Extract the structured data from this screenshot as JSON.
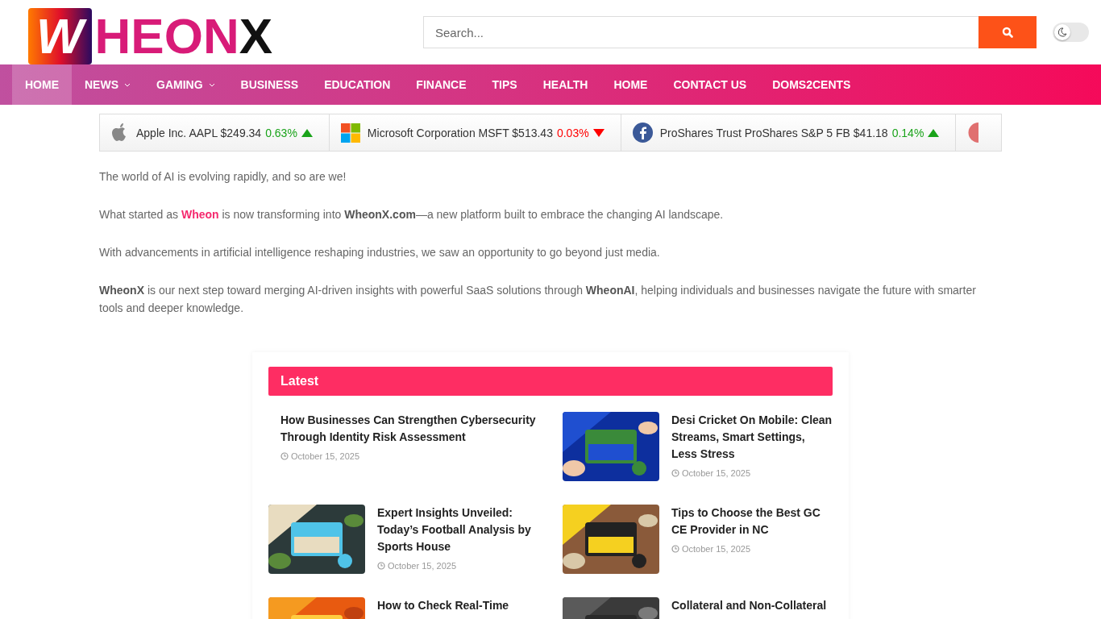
{
  "logo": {
    "mark": "W",
    "name": "HEON",
    "suffix": "X"
  },
  "search": {
    "placeholder": "Search..."
  },
  "dark_mode_toggle": {
    "on": false
  },
  "nav": [
    {
      "label": "HOME",
      "selected": true,
      "dropdown": false
    },
    {
      "label": "NEWS",
      "selected": false,
      "dropdown": true
    },
    {
      "label": "GAMING",
      "selected": false,
      "dropdown": true
    },
    {
      "label": "BUSINESS",
      "selected": false,
      "dropdown": false
    },
    {
      "label": "EDUCATION",
      "selected": false,
      "dropdown": false
    },
    {
      "label": "FINANCE",
      "selected": false,
      "dropdown": false
    },
    {
      "label": "TIPS",
      "selected": false,
      "dropdown": false
    },
    {
      "label": "HEALTH",
      "selected": false,
      "dropdown": false
    },
    {
      "label": "HOME",
      "selected": false,
      "dropdown": false
    },
    {
      "label": "CONTACT US",
      "selected": false,
      "dropdown": false
    },
    {
      "label": "DOMS2CENTS",
      "selected": false,
      "dropdown": false
    }
  ],
  "ticker": [
    {
      "kind": "apple",
      "name": "Apple Inc. AAPL $249.34",
      "change": "0.63%",
      "rising": true
    },
    {
      "kind": "windows",
      "name": "Microsoft Corporation MSFT $513.43",
      "change": "0.03%",
      "rising": false
    },
    {
      "kind": "facebook",
      "name": "ProShares Trust ProShares S&P 5 FB $41.18",
      "change": "0.14%",
      "rising": true
    },
    {
      "kind": "partial"
    }
  ],
  "intro": [
    [
      {
        "kind": "plain",
        "text": "The world of AI is evolving rapidly, and so are we!"
      }
    ],
    [
      {
        "kind": "plain",
        "text": "What started as "
      },
      {
        "kind": "link",
        "text": "Wheon"
      },
      {
        "kind": "plain",
        "text": " is now transforming into "
      },
      {
        "kind": "bold",
        "text": "WheonX.com"
      },
      {
        "kind": "plain",
        "text": "—a new platform built to embrace the changing AI landscape."
      }
    ],
    [
      {
        "kind": "plain",
        "text": "With advancements in artificial intelligence reshaping industries, we saw an opportunity to go beyond just media."
      }
    ],
    [
      {
        "kind": "bold",
        "text": "WheonX"
      },
      {
        "kind": "plain",
        "text": " is our next step toward merging AI-driven insights with powerful SaaS solutions through "
      },
      {
        "kind": "bold",
        "text": "WheonAI"
      },
      {
        "kind": "plain",
        "text": ", helping individuals and businesses navigate the future with smarter tools and deeper knowledge."
      }
    ]
  ],
  "latest": {
    "heading": "Latest",
    "articles": [
      {
        "title": "How Businesses Can Strengthen Cybersecurity Through Identity Risk Assessment",
        "date": "October 15, 2025"
      },
      {
        "title": "Desi Cricket On Mobile: Clean Streams, Smart Settings, Less Stress",
        "date": "October 15, 2025",
        "kind": "picture"
      },
      {
        "title": "Expert Insights Unveiled: Today’s Football Analysis by Sports House",
        "date": "October 15, 2025",
        "kind": "picture"
      },
      {
        "title": "Tips to Choose the Best GC CE Provider in NC",
        "date": "October 15, 2025",
        "kind": "picture"
      },
      {
        "title": "How to Check Real-Time",
        "kind": "picture"
      },
      {
        "title": "Collateral and Non-Collateral",
        "kind": "picture"
      }
    ]
  }
}
